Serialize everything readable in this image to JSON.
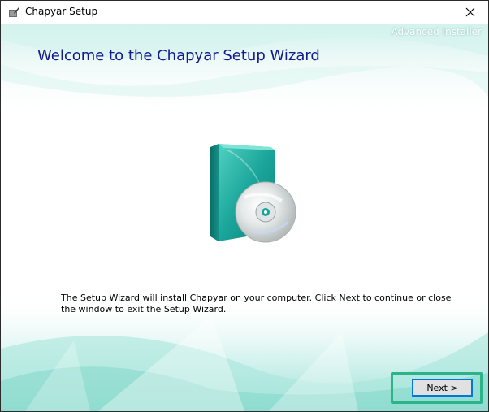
{
  "window": {
    "title": "Chapyar Setup",
    "brand": "Advanced Installer"
  },
  "content": {
    "heading": "Welcome to the Chapyar Setup Wizard",
    "message": "The Setup Wizard will install Chapyar on your computer. Click Next to continue or close the window to exit the Setup Wizard."
  },
  "buttons": {
    "next_label": "Next >"
  },
  "icons": {
    "app": "setup-app-icon",
    "close": "close-icon",
    "product": "software-box-cd-icon"
  },
  "colors": {
    "heading": "#13198f",
    "accent": "#2db38a",
    "teal": "#1aa59a",
    "button_border": "#0078d7"
  }
}
